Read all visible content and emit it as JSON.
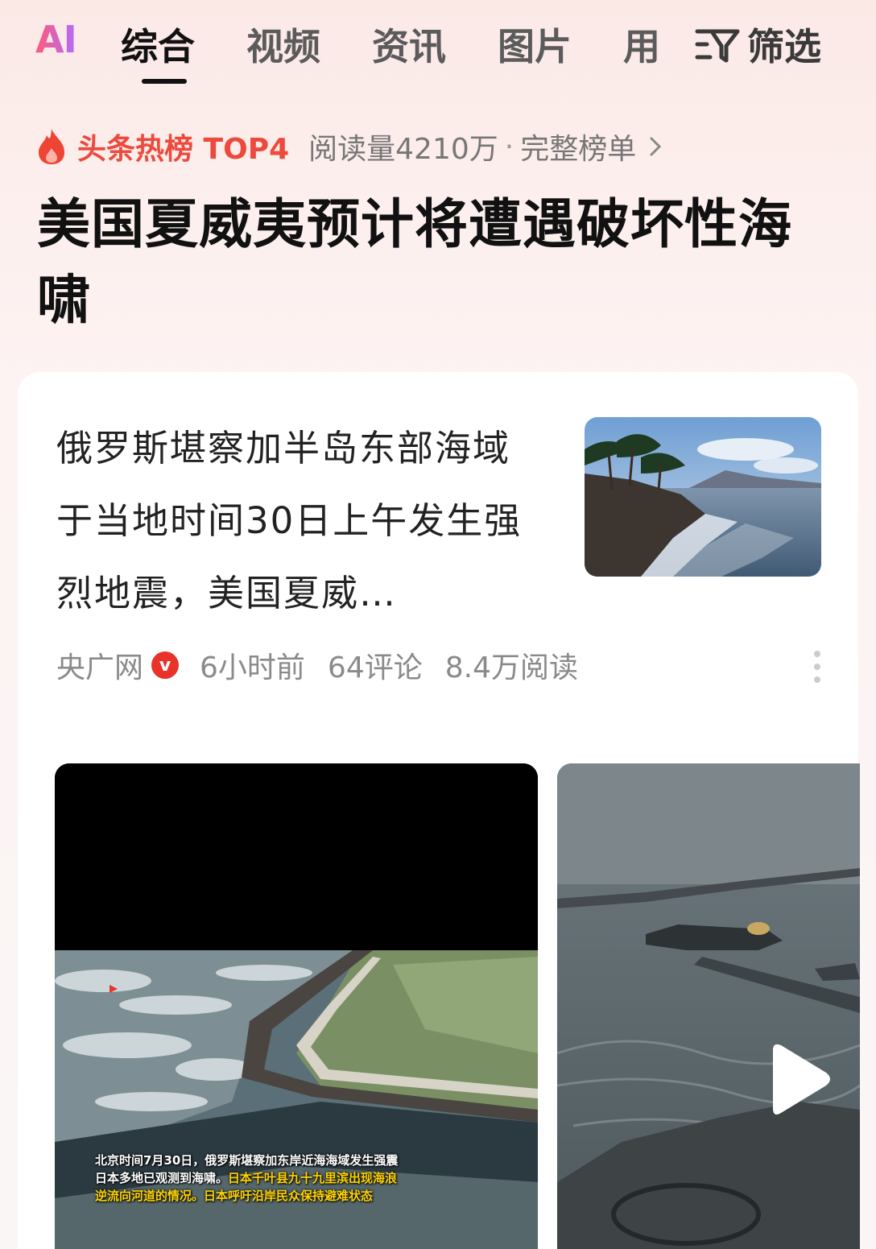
{
  "tabs": {
    "ai_label": "AI",
    "items": [
      "综合",
      "视频",
      "资讯",
      "图片",
      "用"
    ],
    "filter_label": "筛选"
  },
  "hotlist": {
    "label": "头条热榜 TOP4",
    "reads": "阅读量4210万",
    "separator": "·",
    "link": "完整榜单"
  },
  "headline": "美国夏威夷预计将遭遇破坏性海啸",
  "article": {
    "summary": "俄罗斯堪察加半岛东部海域于当地时间30日上午发生强烈地震，美国夏威…",
    "source": "央广网",
    "verified_badge": "v",
    "time": "6小时前",
    "comments": "64评论",
    "reads": "8.4万阅读"
  },
  "video1": {
    "caption_line1": "北京时间7月30日，俄罗斯堪察加东岸近海海域发生强震",
    "caption_line2": "日本多地已观测到海啸。日本千叶县九十九里滨出现海浪",
    "caption_line3": "逆流向河道的情况。日本呼吁沿岸民众保持避难状态"
  },
  "colors": {
    "accent_red": "#ec4a3d",
    "badge_red": "#e8322a"
  },
  "icons": [
    "flame-icon",
    "filter-icon",
    "chevron-right-icon",
    "more-vertical-icon",
    "play-icon"
  ]
}
